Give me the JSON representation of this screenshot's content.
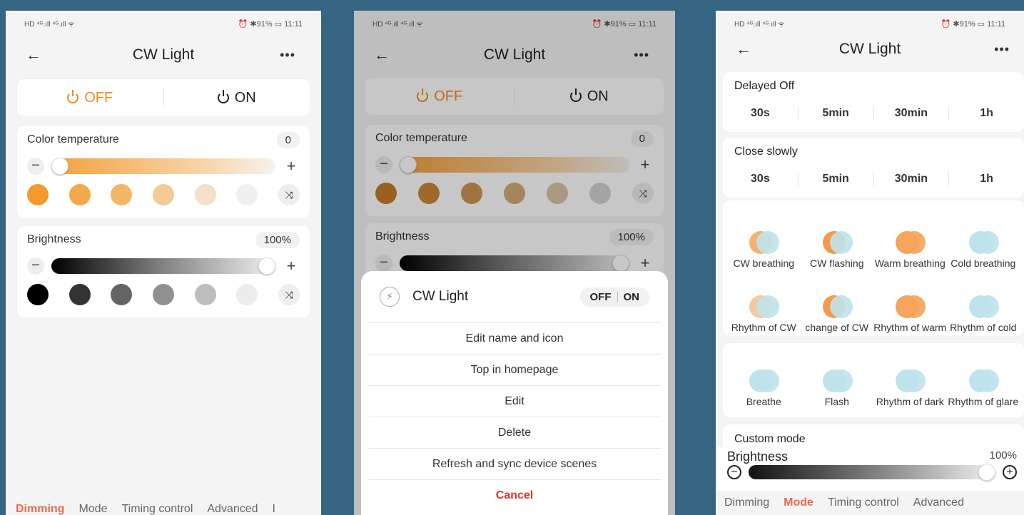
{
  "status": {
    "left": "HD ⁴ᴳ.ıll ⁴ᴳ.ıll ᯤ",
    "right": "⏰ ✱91% ▭ 11:11"
  },
  "panel1": {
    "title": "CW Light",
    "off_label": "OFF",
    "on_label": "ON",
    "color_temp_label": "Color temperature",
    "color_temp_value": "0",
    "brightness_label": "Brightness",
    "brightness_value": "100%",
    "temp_swatches": [
      "#f39a2f",
      "#f3a84a",
      "#f2b868",
      "#f3cc95",
      "#f3e1c8",
      "#f0f0f0"
    ],
    "gray_swatches": [
      "#000000",
      "#333333",
      "#646464",
      "#909090",
      "#bdbdbd",
      "#ececec"
    ],
    "tabs": [
      "Dimming",
      "Mode",
      "Timing control",
      "Advanced",
      "I"
    ],
    "active_tab": 0
  },
  "panel2": {
    "title": "CW Light",
    "off_label": "OFF",
    "on_label": "ON",
    "color_temp_label": "Color temperature",
    "color_temp_value": "0",
    "brightness_label": "Brightness",
    "brightness_value": "100%",
    "sheet": {
      "device_name": "CW Light",
      "toggle_off": "OFF",
      "toggle_on": "ON",
      "items": [
        "Edit name and icon",
        "Top in homepage",
        "Edit",
        "Delete",
        "Refresh and sync device scenes"
      ],
      "cancel": "Cancel"
    }
  },
  "panel3": {
    "title": "CW Light",
    "delayed_off": {
      "label": "Delayed Off",
      "options": [
        "30s",
        "5min",
        "30min",
        "1h"
      ]
    },
    "close_slowly": {
      "label": "Close slowly",
      "options": [
        "30s",
        "5min",
        "30min",
        "1h"
      ]
    },
    "modes_a": [
      {
        "label": "CW breathing",
        "c1": "#f5b26f",
        "c2": "#bfe3ea"
      },
      {
        "label": "CW flashing",
        "c1": "#f39a4d",
        "c2": "#bfe3ea"
      },
      {
        "label": "Warm breathing",
        "c1": "#f5a55c",
        "c2": "#f5a55c"
      },
      {
        "label": "Cold breathing",
        "c1": "#bfe3ea",
        "c2": "#bfe3ea"
      },
      {
        "label": "Rhythm of CW",
        "c1": "#f7c89b",
        "c2": "#bfe3ea"
      },
      {
        "label": "change of CW",
        "c1": "#f39a4d",
        "c2": "#bfe3ea"
      },
      {
        "label": "Rhythm of warm",
        "c1": "#f5a55c",
        "c2": "#f5a55c"
      },
      {
        "label": "Rhythm of cold",
        "c1": "#bfe3ea",
        "c2": "#bfe3ea"
      }
    ],
    "modes_b": [
      {
        "label": "Breathe",
        "c1": "#bfe3ea",
        "c2": "#bfe3ea"
      },
      {
        "label": "Flash",
        "c1": "#bfe3ea",
        "c2": "#bfe3ea"
      },
      {
        "label": "Rhythm of dark",
        "c1": "#bfe3ea",
        "c2": "#bfe3ea"
      },
      {
        "label": "Rhythm of glare",
        "c1": "#bfe3ea",
        "c2": "#bfe3ea"
      }
    ],
    "custom_mode": "Custom mode",
    "brightness_label": "Brightness",
    "brightness_value": "100%",
    "tabs": [
      "Dimming",
      "Mode",
      "Timing control",
      "Advanced"
    ],
    "active_tab": 1
  },
  "colors": {
    "accent_orange": "#f08a1c",
    "tab_active": "#ee6b4d",
    "cancel_red": "#e0342e",
    "background": "#356582"
  }
}
